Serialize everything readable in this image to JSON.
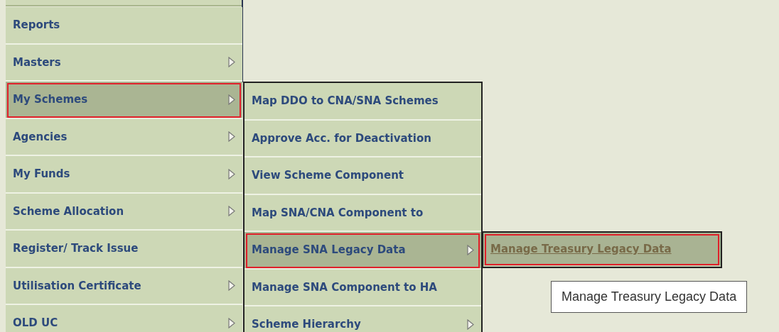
{
  "main_menu": [
    {
      "label": "Reports",
      "has_submenu": false,
      "selected": false
    },
    {
      "label": "Masters",
      "has_submenu": true,
      "selected": false
    },
    {
      "label": "My Schemes",
      "has_submenu": true,
      "selected": true
    },
    {
      "label": "Agencies",
      "has_submenu": true,
      "selected": false
    },
    {
      "label": "My Funds",
      "has_submenu": true,
      "selected": false
    },
    {
      "label": "Scheme Allocation",
      "has_submenu": true,
      "selected": false
    },
    {
      "label": "Register/ Track Issue",
      "has_submenu": false,
      "selected": false
    },
    {
      "label": "Utilisation Certificate",
      "has_submenu": true,
      "selected": false
    },
    {
      "label": "OLD UC",
      "has_submenu": true,
      "selected": false
    }
  ],
  "submenu": [
    {
      "label": "Map DDO to CNA/SNA Schemes",
      "has_submenu": false,
      "selected": false
    },
    {
      "label": "Approve Acc. for Deactivation",
      "has_submenu": false,
      "selected": false
    },
    {
      "label": "View Scheme Component",
      "has_submenu": false,
      "selected": false
    },
    {
      "label": "Map SNA/CNA Component to",
      "has_submenu": false,
      "selected": false
    },
    {
      "label": "Manage SNA Legacy Data",
      "has_submenu": true,
      "selected": true
    },
    {
      "label": "Manage SNA Component to HA",
      "has_submenu": false,
      "selected": false
    },
    {
      "label": "Scheme Hierarchy",
      "has_submenu": true,
      "selected": false
    }
  ],
  "flyout": [
    {
      "label": "Manage Treasury Legacy Data",
      "has_submenu": false,
      "selected": true
    }
  ],
  "tooltip": "Manage Treasury Legacy Data"
}
